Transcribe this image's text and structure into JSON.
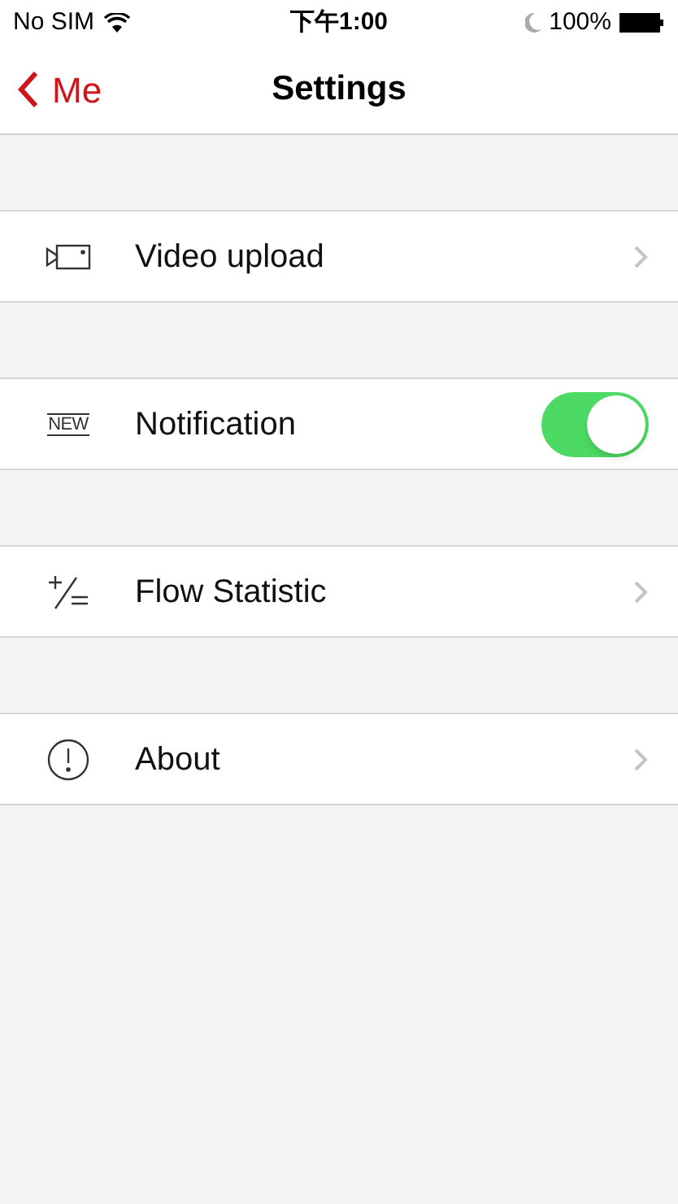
{
  "status_bar": {
    "carrier": "No SIM",
    "time": "下午1:00",
    "battery": "100%"
  },
  "nav": {
    "back": "Me",
    "title": "Settings"
  },
  "items": [
    {
      "kind": "link",
      "label": "Video upload"
    },
    {
      "kind": "toggle",
      "icon_text": "NEW",
      "label": "Notification",
      "on": true
    },
    {
      "kind": "link",
      "label": "Flow Statistic"
    },
    {
      "kind": "link",
      "label": "About"
    }
  ]
}
